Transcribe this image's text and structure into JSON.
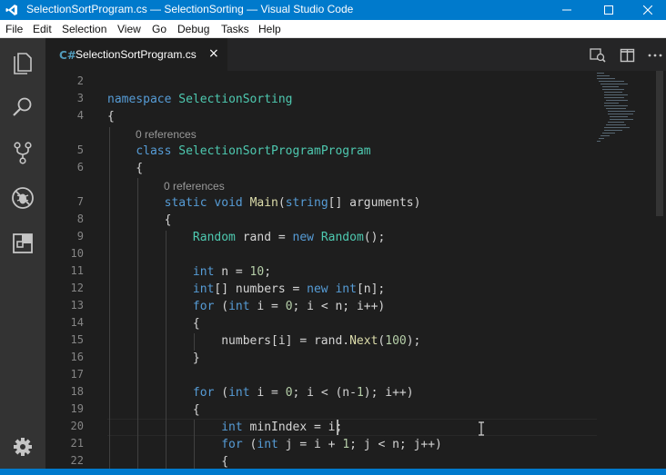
{
  "window": {
    "title": "SelectionSortProgram.cs — SelectionSorting — Visual Studio Code",
    "icon": "vscode-icon",
    "controls": [
      "minimize-icon",
      "maximize-icon",
      "close-icon"
    ]
  },
  "menu": [
    "File",
    "Edit",
    "Selection",
    "View",
    "Go",
    "Debug",
    "Tasks",
    "Help"
  ],
  "activity_bar": {
    "icons": [
      "explorer-icon",
      "search-icon",
      "source-control-icon",
      "debug-icon",
      "extensions-icon"
    ],
    "bottom_icon": "gear-icon"
  },
  "tab": {
    "icon_glyph": "C#",
    "label": "SelectionSortProgram.cs",
    "close": "×"
  },
  "editor_actions": [
    "open-preview-icon",
    "split-editor-icon",
    "more-actions-icon"
  ],
  "line_numbers": [
    "2",
    "3",
    "4",
    "",
    "5",
    "6",
    "",
    "7",
    "8",
    "9",
    "10",
    "11",
    "12",
    "13",
    "14",
    "15",
    "16",
    "17",
    "18",
    "19",
    "20",
    "21",
    "22"
  ],
  "code_lens": [
    "0 references",
    "0 references"
  ],
  "colors": {
    "title_bar": "#007acc",
    "editor_bg": "#1e1e1e",
    "activity_bar": "#333333",
    "keyword": "#569cd6",
    "type": "#4ec9b0",
    "function": "#dcdcaa",
    "number": "#b5cea8",
    "text": "#d4d4d4"
  }
}
